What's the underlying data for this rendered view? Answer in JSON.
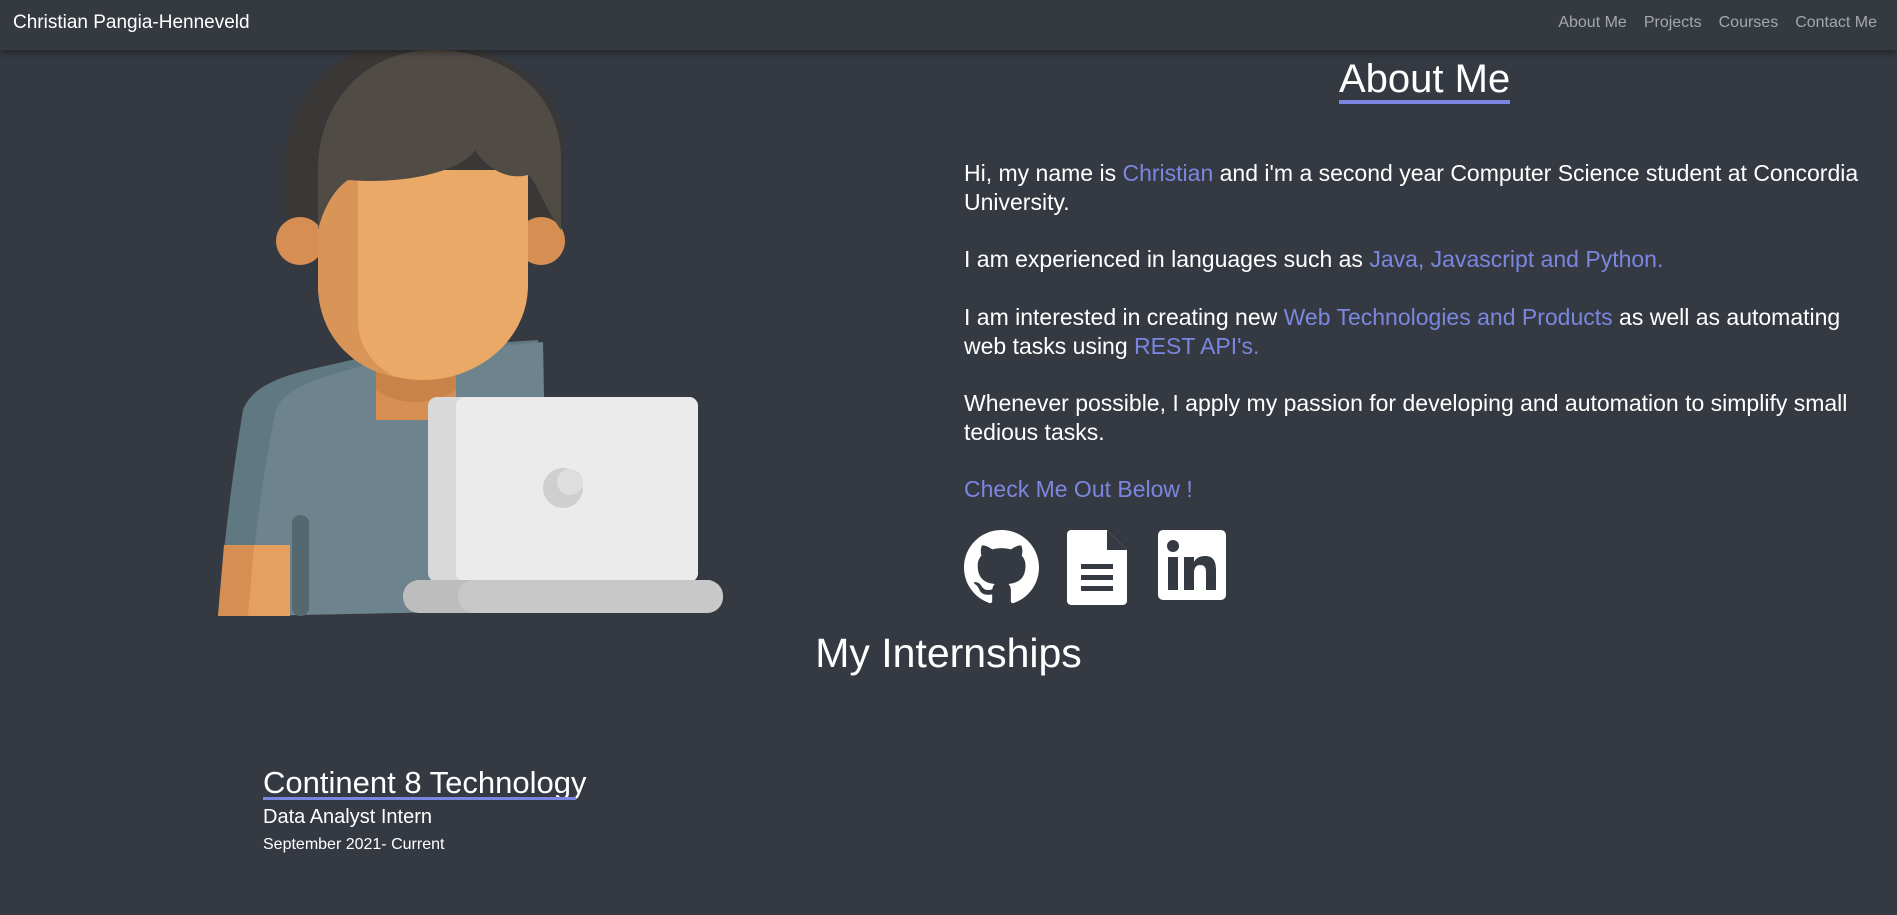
{
  "navbar": {
    "brand": "Christian Pangia-Henneveld",
    "links": [
      "About Me",
      "Projects",
      "Courses",
      "Contact Me"
    ]
  },
  "about": {
    "title": "About Me",
    "p1": {
      "a": "Hi, my name is ",
      "highlight": "Christian",
      "b": " and i'm a second year Computer Science student at Concordia University."
    },
    "p2": {
      "a": "I am experienced in languages such as ",
      "highlight": "Java, Javascript and Python."
    },
    "p3": {
      "a": "I am interested in creating new ",
      "highlight": "Web Technologies and Products",
      "b": " as well as automating web tasks using ",
      "highlight2": "REST API's."
    },
    "p4": "Whenever possible, I apply my passion for developing and automation to simplify small tedious tasks.",
    "cta": "Check Me Out Below !"
  },
  "socials": [
    {
      "icon": "github-icon"
    },
    {
      "icon": "document-icon"
    },
    {
      "icon": "linkedin-icon"
    }
  ],
  "internships": {
    "title": "My Internships",
    "items": [
      {
        "company": "Continent 8 Technology",
        "role": "Data Analyst Intern",
        "dates": "September 2021- Current"
      }
    ]
  },
  "colors": {
    "background": "#353a42",
    "navbar": "#343a40",
    "accent": "#7b86e0",
    "text": "#ffffff",
    "nav_text": "#a4a8ad"
  }
}
